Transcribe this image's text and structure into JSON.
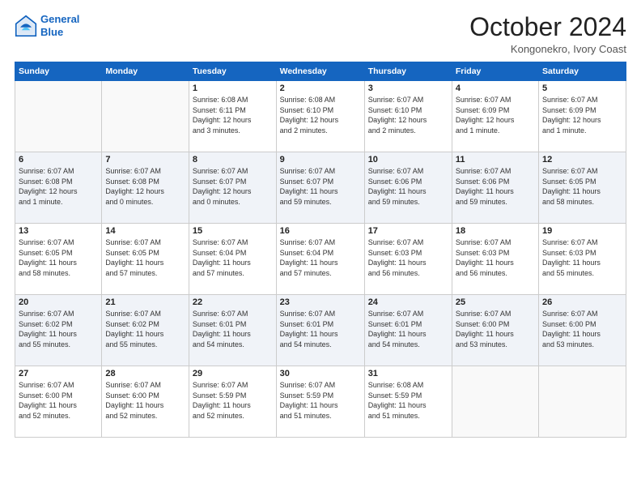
{
  "logo": {
    "line1": "General",
    "line2": "Blue"
  },
  "title": "October 2024",
  "location": "Kongonekro, Ivory Coast",
  "header": {
    "days": [
      "Sunday",
      "Monday",
      "Tuesday",
      "Wednesday",
      "Thursday",
      "Friday",
      "Saturday"
    ]
  },
  "weeks": [
    {
      "cells": [
        {
          "day": "",
          "info": ""
        },
        {
          "day": "",
          "info": ""
        },
        {
          "day": "1",
          "info": "Sunrise: 6:08 AM\nSunset: 6:11 PM\nDaylight: 12 hours\nand 3 minutes."
        },
        {
          "day": "2",
          "info": "Sunrise: 6:08 AM\nSunset: 6:10 PM\nDaylight: 12 hours\nand 2 minutes."
        },
        {
          "day": "3",
          "info": "Sunrise: 6:07 AM\nSunset: 6:10 PM\nDaylight: 12 hours\nand 2 minutes."
        },
        {
          "day": "4",
          "info": "Sunrise: 6:07 AM\nSunset: 6:09 PM\nDaylight: 12 hours\nand 1 minute."
        },
        {
          "day": "5",
          "info": "Sunrise: 6:07 AM\nSunset: 6:09 PM\nDaylight: 12 hours\nand 1 minute."
        }
      ]
    },
    {
      "cells": [
        {
          "day": "6",
          "info": "Sunrise: 6:07 AM\nSunset: 6:08 PM\nDaylight: 12 hours\nand 1 minute."
        },
        {
          "day": "7",
          "info": "Sunrise: 6:07 AM\nSunset: 6:08 PM\nDaylight: 12 hours\nand 0 minutes."
        },
        {
          "day": "8",
          "info": "Sunrise: 6:07 AM\nSunset: 6:07 PM\nDaylight: 12 hours\nand 0 minutes."
        },
        {
          "day": "9",
          "info": "Sunrise: 6:07 AM\nSunset: 6:07 PM\nDaylight: 11 hours\nand 59 minutes."
        },
        {
          "day": "10",
          "info": "Sunrise: 6:07 AM\nSunset: 6:06 PM\nDaylight: 11 hours\nand 59 minutes."
        },
        {
          "day": "11",
          "info": "Sunrise: 6:07 AM\nSunset: 6:06 PM\nDaylight: 11 hours\nand 59 minutes."
        },
        {
          "day": "12",
          "info": "Sunrise: 6:07 AM\nSunset: 6:05 PM\nDaylight: 11 hours\nand 58 minutes."
        }
      ]
    },
    {
      "cells": [
        {
          "day": "13",
          "info": "Sunrise: 6:07 AM\nSunset: 6:05 PM\nDaylight: 11 hours\nand 58 minutes."
        },
        {
          "day": "14",
          "info": "Sunrise: 6:07 AM\nSunset: 6:05 PM\nDaylight: 11 hours\nand 57 minutes."
        },
        {
          "day": "15",
          "info": "Sunrise: 6:07 AM\nSunset: 6:04 PM\nDaylight: 11 hours\nand 57 minutes."
        },
        {
          "day": "16",
          "info": "Sunrise: 6:07 AM\nSunset: 6:04 PM\nDaylight: 11 hours\nand 57 minutes."
        },
        {
          "day": "17",
          "info": "Sunrise: 6:07 AM\nSunset: 6:03 PM\nDaylight: 11 hours\nand 56 minutes."
        },
        {
          "day": "18",
          "info": "Sunrise: 6:07 AM\nSunset: 6:03 PM\nDaylight: 11 hours\nand 56 minutes."
        },
        {
          "day": "19",
          "info": "Sunrise: 6:07 AM\nSunset: 6:03 PM\nDaylight: 11 hours\nand 55 minutes."
        }
      ]
    },
    {
      "cells": [
        {
          "day": "20",
          "info": "Sunrise: 6:07 AM\nSunset: 6:02 PM\nDaylight: 11 hours\nand 55 minutes."
        },
        {
          "day": "21",
          "info": "Sunrise: 6:07 AM\nSunset: 6:02 PM\nDaylight: 11 hours\nand 55 minutes."
        },
        {
          "day": "22",
          "info": "Sunrise: 6:07 AM\nSunset: 6:01 PM\nDaylight: 11 hours\nand 54 minutes."
        },
        {
          "day": "23",
          "info": "Sunrise: 6:07 AM\nSunset: 6:01 PM\nDaylight: 11 hours\nand 54 minutes."
        },
        {
          "day": "24",
          "info": "Sunrise: 6:07 AM\nSunset: 6:01 PM\nDaylight: 11 hours\nand 54 minutes."
        },
        {
          "day": "25",
          "info": "Sunrise: 6:07 AM\nSunset: 6:00 PM\nDaylight: 11 hours\nand 53 minutes."
        },
        {
          "day": "26",
          "info": "Sunrise: 6:07 AM\nSunset: 6:00 PM\nDaylight: 11 hours\nand 53 minutes."
        }
      ]
    },
    {
      "cells": [
        {
          "day": "27",
          "info": "Sunrise: 6:07 AM\nSunset: 6:00 PM\nDaylight: 11 hours\nand 52 minutes."
        },
        {
          "day": "28",
          "info": "Sunrise: 6:07 AM\nSunset: 6:00 PM\nDaylight: 11 hours\nand 52 minutes."
        },
        {
          "day": "29",
          "info": "Sunrise: 6:07 AM\nSunset: 5:59 PM\nDaylight: 11 hours\nand 52 minutes."
        },
        {
          "day": "30",
          "info": "Sunrise: 6:07 AM\nSunset: 5:59 PM\nDaylight: 11 hours\nand 51 minutes."
        },
        {
          "day": "31",
          "info": "Sunrise: 6:08 AM\nSunset: 5:59 PM\nDaylight: 11 hours\nand 51 minutes."
        },
        {
          "day": "",
          "info": ""
        },
        {
          "day": "",
          "info": ""
        }
      ]
    }
  ]
}
